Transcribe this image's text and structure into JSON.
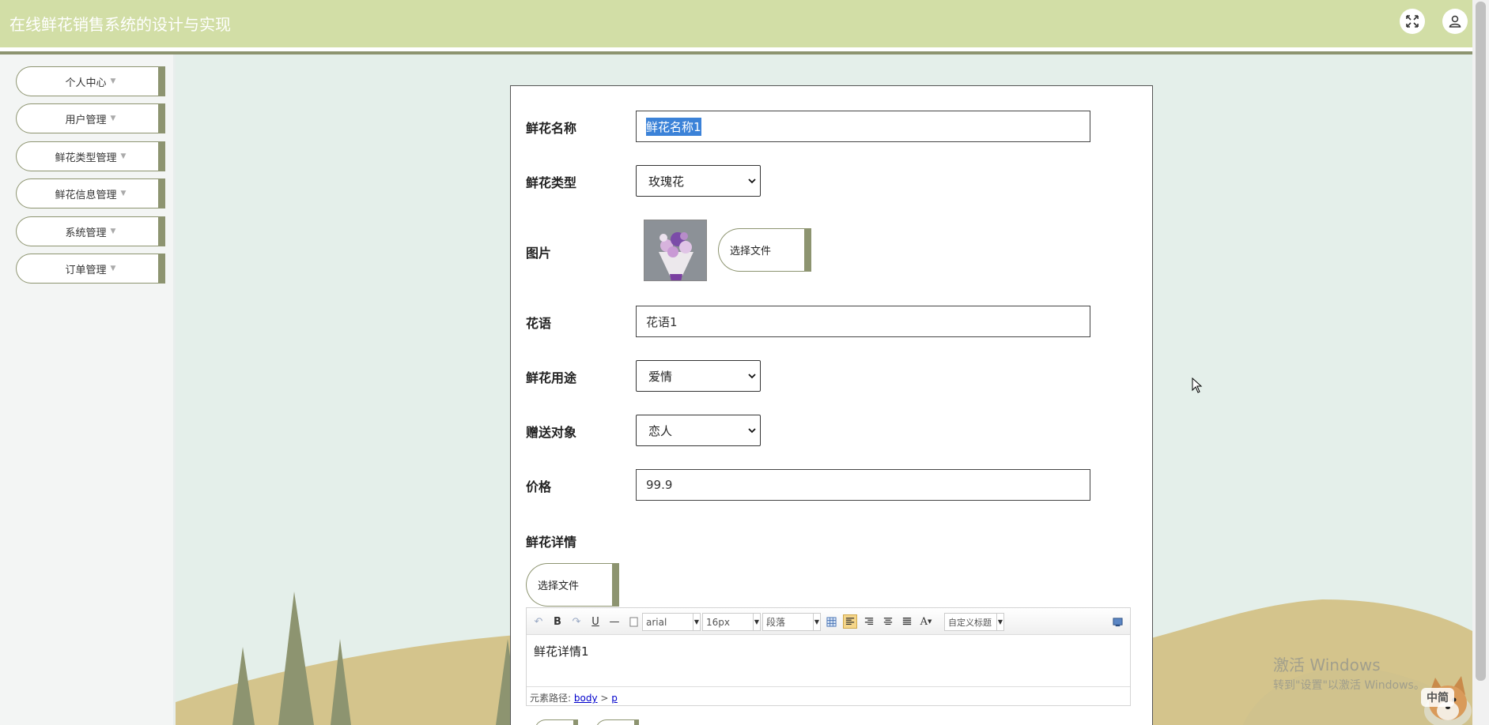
{
  "header": {
    "title": "在线鲜花销售系统的设计与实现",
    "fullscreen_icon": "expand-arrows-icon",
    "user_icon": "user-icon"
  },
  "sidebar": {
    "items": [
      {
        "label": "个人中心",
        "caret": "▼"
      },
      {
        "label": "用户管理",
        "caret": "▼"
      },
      {
        "label": "鲜花类型管理",
        "caret": "▼"
      },
      {
        "label": "鲜花信息管理",
        "caret": "▼"
      },
      {
        "label": "系统管理",
        "caret": "▼"
      },
      {
        "label": "订单管理",
        "caret": "▼"
      }
    ]
  },
  "form": {
    "name_label": "鲜花名称",
    "name_value": "鲜花名称1",
    "type_label": "鲜花类型",
    "type_value": "玫瑰花",
    "image_label": "图片",
    "image_button": "选择文件",
    "language_label": "花语",
    "language_value": "花语1",
    "usage_label": "鲜花用途",
    "usage_value": "爱情",
    "recipient_label": "赠送对象",
    "recipient_value": "恋人",
    "price_label": "价格",
    "price_value": "99.9",
    "detail_label": "鲜花详情",
    "detail_button": "选择文件"
  },
  "editor": {
    "font_family": "arial",
    "font_size": "16px",
    "paragraph": "段落",
    "custom_title": "自定义标题",
    "bold": "B",
    "underline": "U",
    "font_color": "A",
    "content": "鲜花详情1",
    "path_label": "元素路径:",
    "path_body": "body",
    "path_sep": ">",
    "path_p": "p"
  },
  "watermark": {
    "line1": "激活 Windows",
    "line2": "转到\"设置\"以激活 Windows。"
  },
  "ime": {
    "label": "中简"
  }
}
